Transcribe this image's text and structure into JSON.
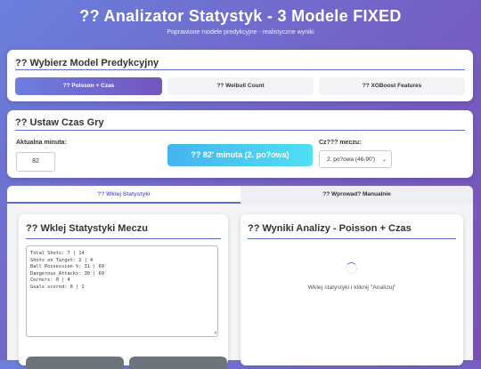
{
  "header": {
    "title": "?? Analizator Statystyk - 3 Modele FIXED",
    "subtitle": "Poprawione modele predykcyjne - realistyczne wyniki"
  },
  "models": {
    "heading": "?? Wybierz Model Predykcyjny",
    "options": [
      {
        "label": "?? Poisson + Czas",
        "active": true
      },
      {
        "label": "?? Weibull Count",
        "active": false
      },
      {
        "label": "?? XGBoost Features",
        "active": false
      }
    ]
  },
  "time": {
    "heading": "?? Ustaw Czas Gry",
    "minute_label": "Aktualna minuta:",
    "minute_value": "82",
    "minute_display": "?? 82' minuta (2. po?owa)",
    "half_label": "Cz??? meczu:",
    "half_value": "2. po?owa (46-90')"
  },
  "tabs": [
    {
      "label": "?? Wklej Statystyki",
      "active": true
    },
    {
      "label": "?? Wprowad? Manualnie",
      "active": false
    }
  ],
  "paste_panel": {
    "heading": "?? Wklej Statystyki Meczu",
    "lines": [
      "Total Shots: 7 | 14",
      "Shots on Target: 2 | 4",
      "Ball Possession %: 31 | 69",
      "Dangerous Attacks: 30 | 69",
      "Corners: 0 | 4",
      "Goals scored: 0 | 1"
    ]
  },
  "results_panel": {
    "heading": "?? Wyniki Analizy - Poisson + Czas",
    "empty_message": "Wklej statystyki i kliknij \"Analizuj\""
  }
}
